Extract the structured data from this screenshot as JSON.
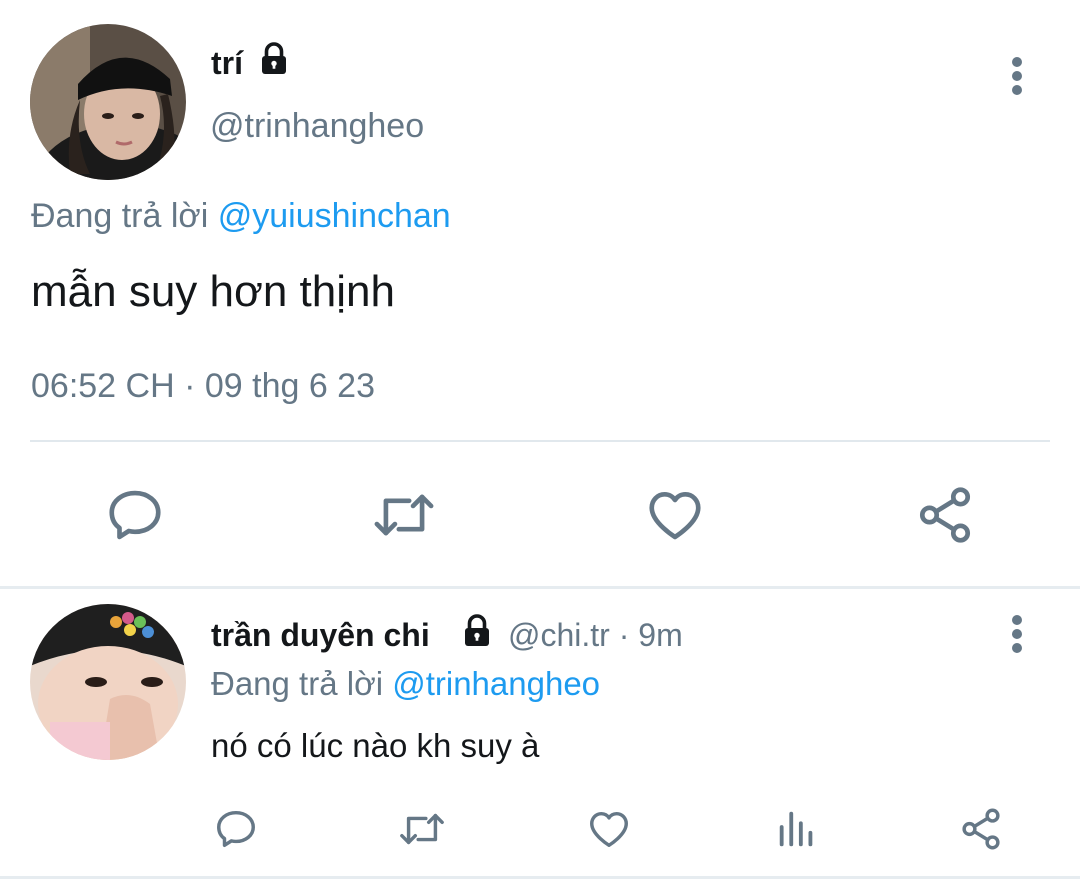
{
  "main_tweet": {
    "author_name": "trí",
    "handle": "@trinhangheo",
    "reply_prefix": "Đang trả lời",
    "reply_to": "@yuiushinchan",
    "text": "mẫn suy hơn thịnh",
    "timestamp": "06:52 CH · 09 thg 6 23"
  },
  "reply_tweet": {
    "author_name": "trần duyên chi",
    "handle": "@chi.tr",
    "age": "· 9m",
    "reply_prefix": "Đang trả lời",
    "reply_to": "@trinhangheo",
    "text": "nó có lúc nào kh suy à"
  },
  "colors": {
    "accent": "#1d9bf0",
    "secondary_text": "#657786",
    "icon": "#657786"
  }
}
